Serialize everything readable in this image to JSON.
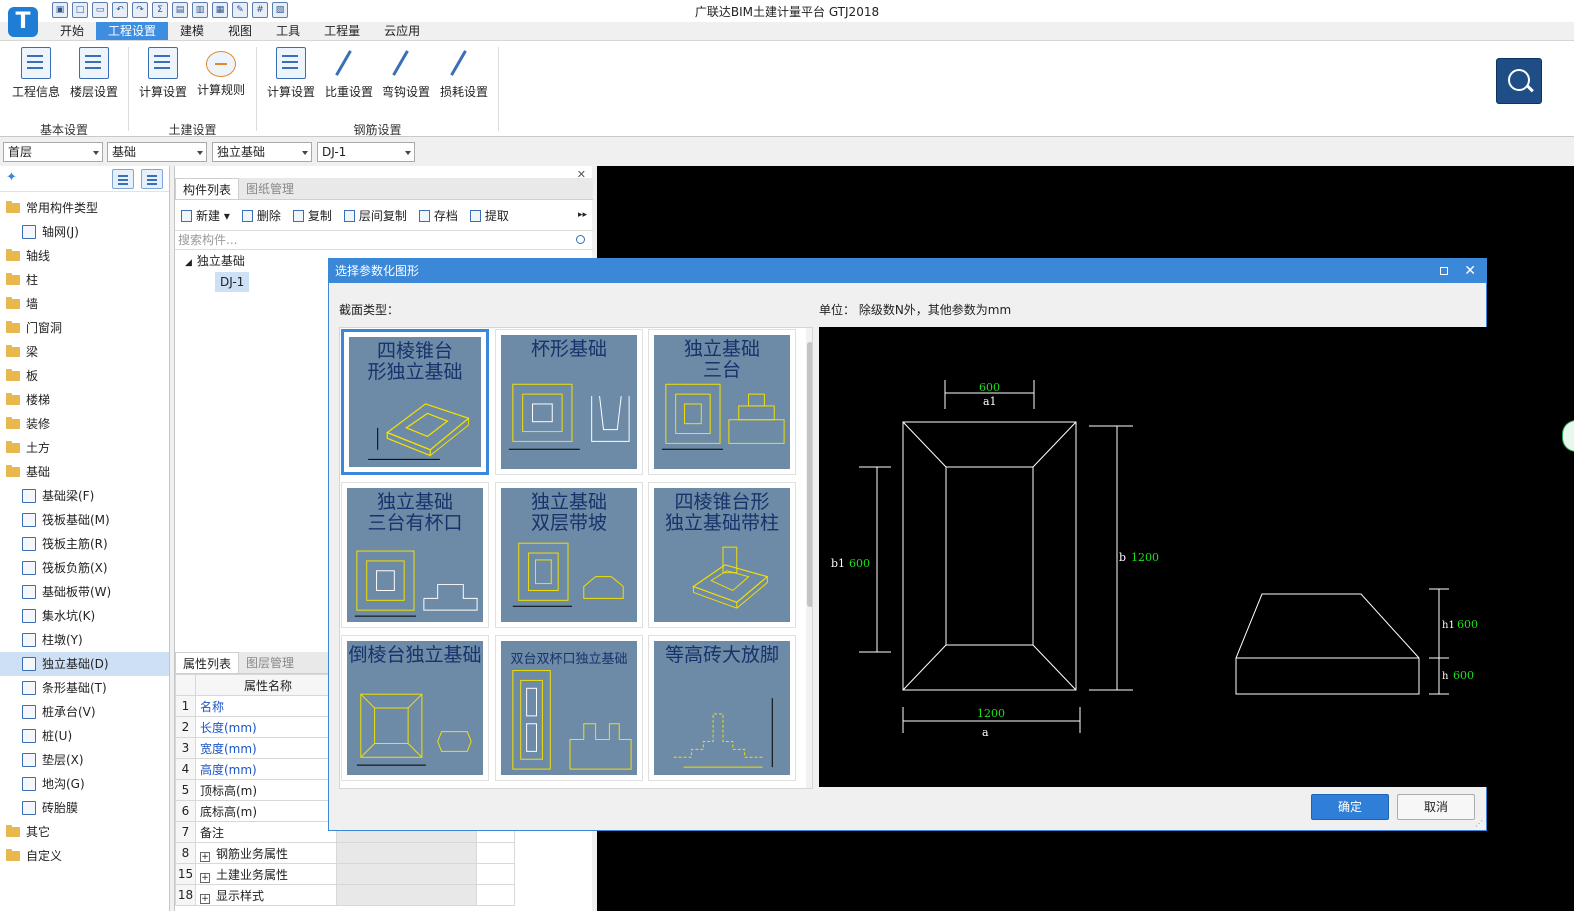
{
  "app": {
    "title": "广联达BIM土建计量平台 GTJ2018",
    "logo_letter": "T",
    "tabs": [
      "开始",
      "工程设置",
      "建模",
      "视图",
      "工具",
      "工程量",
      "云应用"
    ],
    "active_tab": "工程设置"
  },
  "ribbon": {
    "buttons": [
      "工程信息",
      "楼层设置",
      "计算设置",
      "计算规则",
      "计算设置",
      "比重设置",
      "弯钩设置",
      "损耗设置"
    ],
    "groups": [
      "基本设置",
      "土建设置",
      "钢筋设置"
    ]
  },
  "filters": {
    "floor": "首层",
    "category": "基础",
    "type": "独立基础",
    "component": "DJ-1"
  },
  "left_tree": {
    "items": [
      {
        "label": "常用构件类型",
        "kind": "folder"
      },
      {
        "label": "轴网(J)",
        "kind": "child"
      },
      {
        "label": "轴线",
        "kind": "folder"
      },
      {
        "label": "柱",
        "kind": "folder"
      },
      {
        "label": "墙",
        "kind": "folder"
      },
      {
        "label": "门窗洞",
        "kind": "folder"
      },
      {
        "label": "梁",
        "kind": "folder"
      },
      {
        "label": "板",
        "kind": "folder"
      },
      {
        "label": "楼梯",
        "kind": "folder"
      },
      {
        "label": "装修",
        "kind": "folder"
      },
      {
        "label": "土方",
        "kind": "folder"
      },
      {
        "label": "基础",
        "kind": "folder"
      },
      {
        "label": "基础梁(F)",
        "kind": "child"
      },
      {
        "label": "筏板基础(M)",
        "kind": "child"
      },
      {
        "label": "筏板主筋(R)",
        "kind": "child"
      },
      {
        "label": "筏板负筋(X)",
        "kind": "child"
      },
      {
        "label": "基础板带(W)",
        "kind": "child"
      },
      {
        "label": "集水坑(K)",
        "kind": "child"
      },
      {
        "label": "柱墩(Y)",
        "kind": "child"
      },
      {
        "label": "独立基础(D)",
        "kind": "child",
        "selected": true
      },
      {
        "label": "条形基础(T)",
        "kind": "child"
      },
      {
        "label": "桩承台(V)",
        "kind": "child"
      },
      {
        "label": "桩(U)",
        "kind": "child"
      },
      {
        "label": "垫层(X)",
        "kind": "child"
      },
      {
        "label": "地沟(G)",
        "kind": "child"
      },
      {
        "label": "砖胎膜",
        "kind": "child"
      },
      {
        "label": "其它",
        "kind": "folder"
      },
      {
        "label": "自定义",
        "kind": "folder"
      }
    ]
  },
  "component_panel": {
    "tabs": [
      "构件列表",
      "图纸管理"
    ],
    "toolbar": [
      "新建",
      "删除",
      "复制",
      "层间复制",
      "存档",
      "提取"
    ],
    "search_placeholder": "搜索构件...",
    "tree_root": "独立基础",
    "tree_leaf": "DJ-1"
  },
  "property_panel": {
    "tabs": [
      "属性列表",
      "图层管理"
    ],
    "header": "属性名称",
    "rows": [
      {
        "num": "1",
        "name": "名称",
        "blue": true,
        "expand": false
      },
      {
        "num": "2",
        "name": "长度(mm)",
        "blue": true,
        "expand": false
      },
      {
        "num": "3",
        "name": "宽度(mm)",
        "blue": true,
        "expand": false
      },
      {
        "num": "4",
        "name": "高度(mm)",
        "blue": true,
        "expand": false
      },
      {
        "num": "5",
        "name": "顶标高(m)",
        "blue": false,
        "expand": false
      },
      {
        "num": "6",
        "name": "底标高(m)",
        "blue": false,
        "expand": false
      },
      {
        "num": "7",
        "name": "备注",
        "blue": false,
        "expand": false
      },
      {
        "num": "8",
        "name": "钢筋业务属性",
        "blue": false,
        "expand": true
      },
      {
        "num": "15",
        "name": "土建业务属性",
        "blue": false,
        "expand": true
      },
      {
        "num": "18",
        "name": "显示样式",
        "blue": false,
        "expand": true
      }
    ]
  },
  "dialog": {
    "title": "选择参数化图形",
    "section_label": "截面类型：",
    "unit_label": "单位： 除级数N外，其他参数为mm",
    "tiles": [
      {
        "title": "四棱锥台 形独立基础",
        "selected": true
      },
      {
        "title": "杯形基础",
        "selected": false
      },
      {
        "title": "独立基础 三台",
        "selected": false
      },
      {
        "title": "独立基础 三台有杯口",
        "selected": false
      },
      {
        "title": "独立基础 双层带坡",
        "selected": false
      },
      {
        "title": "四棱锥台形 独立基础带柱",
        "selected": false
      },
      {
        "title": "倒棱台独立基础",
        "selected": false
      },
      {
        "title": "双台双杯口独立基础",
        "selected": false
      },
      {
        "title": "等高砖大放脚",
        "selected": false
      }
    ],
    "ok_label": "确定",
    "cancel_label": "取消"
  },
  "preview": {
    "a1_label": "a1",
    "a1_value": "600",
    "b1_label": "b1",
    "b1_value": "600",
    "b_label": "b",
    "b_value": "1200",
    "a_label": "a",
    "a_value": "1200",
    "h1_label": "h1",
    "h1_value": "600",
    "h_label": "h",
    "h_value": "600",
    "value_color": "#19e019",
    "line_color": "#ffffff"
  }
}
